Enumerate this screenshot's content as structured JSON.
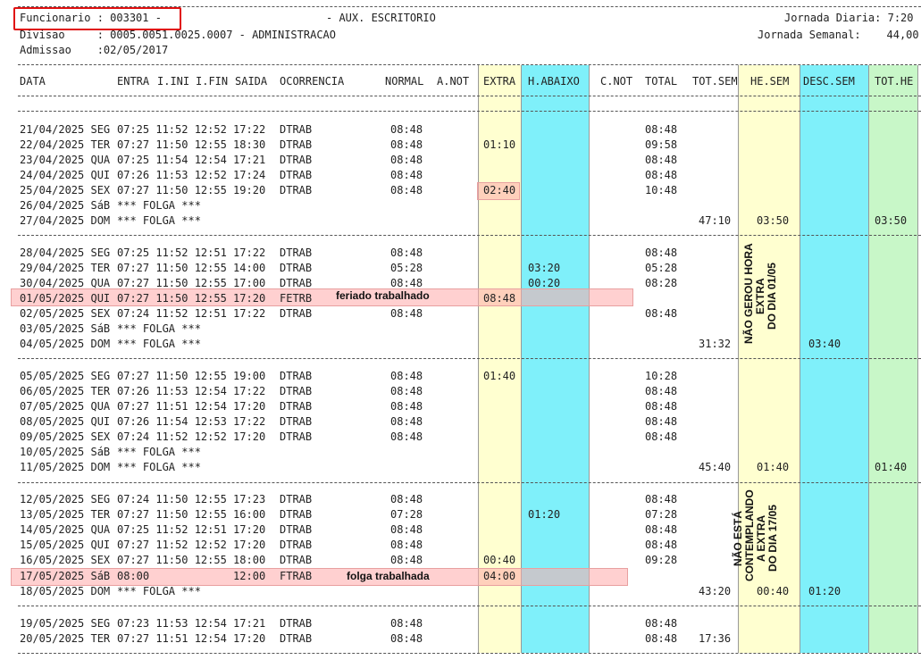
{
  "header": {
    "funcionario": "Funcionario : 003301 -",
    "cargo": "- AUX. ESCRITORIO",
    "divisao": "Divisao     : 0005.0051.0025.0007 - ADMINISTRACAO",
    "admissao": "Admissao    :02/05/2017",
    "jornada_diaria": "Jornada Diaria: 7:20",
    "jornada_semanal": "Jornada Semanal:    44,00"
  },
  "columns": {
    "data": "DATA",
    "entra": "ENTRA",
    "iini": "I.INI",
    "ifin": "I.FIN",
    "saida": "SAIDA",
    "ocorrencia": "OCORRENCIA",
    "normal": "NORMAL",
    "anot": "A.NOT",
    "extra": "EXTRA",
    "habaixo": "H.ABAIXO",
    "cnot": "C.NOT",
    "total": "TOTAL",
    "totsem": "TOT.SEM",
    "hesem": "HE.SEM",
    "descsem": "DESC.SEM",
    "tothe": "TOT.HE"
  },
  "colors": {
    "extra_bg": "#ffffd0",
    "habaixo_bg": "#7ff0fa",
    "hesem_bg": "#ffffd0",
    "descsem_bg": "#7ff0fa",
    "tothe_bg": "#c8f7c8",
    "highlight": "#f8b4b4",
    "redbox": "#e01010"
  },
  "rows": [
    {
      "date": "21/04/2025 SEG",
      "times": "07:25 11:52 12:52 17:22",
      "oc": "DTRAB",
      "normal": "08:48",
      "total": "08:48"
    },
    {
      "date": "22/04/2025 TER",
      "times": "07:27 11:50 12:55 18:30",
      "oc": "DTRAB",
      "normal": "08:48",
      "extra": "01:10",
      "total": "09:58"
    },
    {
      "date": "23/04/2025 QUA",
      "times": "07:25 11:54 12:54 17:21",
      "oc": "DTRAB",
      "normal": "08:48",
      "total": "08:48"
    },
    {
      "date": "24/04/2025 QUI",
      "times": "07:26 11:53 12:52 17:24",
      "oc": "DTRAB",
      "normal": "08:48",
      "total": "08:48"
    },
    {
      "date": "25/04/2025 SEX",
      "times": "07:27 11:50 12:55 19:20",
      "oc": "DTRAB",
      "normal": "08:48",
      "extra": "02:40",
      "total": "10:48"
    },
    {
      "date": "26/04/2025 SáB",
      "times": "*** FOLGA ***"
    },
    {
      "date": "27/04/2025 DOM",
      "times": "*** FOLGA ***",
      "totsem": "47:10",
      "hesem": "03:50",
      "tothe": "03:50"
    },
    {
      "date": "28/04/2025 SEG",
      "times": "07:25 11:52 12:51 17:22",
      "oc": "DTRAB",
      "normal": "08:48",
      "total": "08:48"
    },
    {
      "date": "29/04/2025 TER",
      "times": "07:27 11:50 12:55 14:00",
      "oc": "DTRAB",
      "normal": "05:28",
      "habaixo": "03:20",
      "total": "05:28"
    },
    {
      "date": "30/04/2025 QUA",
      "times": "07:27 11:50 12:55 17:00",
      "oc": "DTRAB",
      "normal": "08:48",
      "habaixo": "00:20",
      "total": "08:28"
    },
    {
      "date": "01/05/2025 QUI",
      "times": "07:27 11:50 12:55 17:20",
      "oc": "FETRB",
      "extra": "08:48"
    },
    {
      "date": "02/05/2025 SEX",
      "times": "07:24 11:52 12:51 17:22",
      "oc": "DTRAB",
      "normal": "08:48",
      "total": "08:48"
    },
    {
      "date": "03/05/2025 SáB",
      "times": "*** FOLGA ***"
    },
    {
      "date": "04/05/2025 DOM",
      "times": "*** FOLGA ***",
      "totsem": "31:32",
      "descsem": "03:40"
    },
    {
      "date": "05/05/2025 SEG",
      "times": "07:27 11:50 12:55 19:00",
      "oc": "DTRAB",
      "normal": "08:48",
      "extra": "01:40",
      "total": "10:28"
    },
    {
      "date": "06/05/2025 TER",
      "times": "07:26 11:53 12:54 17:22",
      "oc": "DTRAB",
      "normal": "08:48",
      "total": "08:48"
    },
    {
      "date": "07/05/2025 QUA",
      "times": "07:27 11:51 12:54 17:20",
      "oc": "DTRAB",
      "normal": "08:48",
      "total": "08:48"
    },
    {
      "date": "08/05/2025 QUI",
      "times": "07:26 11:54 12:53 17:22",
      "oc": "DTRAB",
      "normal": "08:48",
      "total": "08:48"
    },
    {
      "date": "09/05/2025 SEX",
      "times": "07:24 11:52 12:52 17:20",
      "oc": "DTRAB",
      "normal": "08:48",
      "total": "08:48"
    },
    {
      "date": "10/05/2025 SáB",
      "times": "*** FOLGA ***"
    },
    {
      "date": "11/05/2025 DOM",
      "times": "*** FOLGA ***",
      "totsem": "45:40",
      "hesem": "01:40",
      "tothe": "01:40"
    },
    {
      "date": "12/05/2025 SEG",
      "times": "07:24 11:50 12:55 17:23",
      "oc": "DTRAB",
      "normal": "08:48",
      "total": "08:48"
    },
    {
      "date": "13/05/2025 TER",
      "times": "07:27 11:50 12:55 16:00",
      "oc": "DTRAB",
      "normal": "07:28",
      "habaixo": "01:20",
      "total": "07:28"
    },
    {
      "date": "14/05/2025 QUA",
      "times": "07:25 11:52 12:51 17:20",
      "oc": "DTRAB",
      "normal": "08:48",
      "total": "08:48"
    },
    {
      "date": "15/05/2025 QUI",
      "times": "07:27 11:52 12:52 17:20",
      "oc": "DTRAB",
      "normal": "08:48",
      "total": "08:48"
    },
    {
      "date": "16/05/2025 SEX",
      "times": "07:27 11:50 12:55 18:00",
      "oc": "DTRAB",
      "normal": "08:48",
      "extra": "00:40",
      "total": "09:28"
    },
    {
      "date": "17/05/2025 SáB",
      "times": "08:00             12:00",
      "oc": "FTRAB",
      "extra": "04:00"
    },
    {
      "date": "18/05/2025 DOM",
      "times": "*** FOLGA ***",
      "totsem": "43:20",
      "hesem": "00:40",
      "descsem": "01:20"
    },
    {
      "date": "19/05/2025 SEG",
      "times": "07:23 11:53 12:54 17:21",
      "oc": "DTRAB",
      "normal": "08:48",
      "total": "08:48"
    },
    {
      "date": "20/05/2025 TER",
      "times": "07:27 11:51 12:54 17:20",
      "oc": "DTRAB",
      "normal": "08:48",
      "total": "08:48",
      "totsem": "17:36"
    }
  ],
  "annotations": {
    "feriado": "feriado trabalhado",
    "folga": "folga trabalhada",
    "note1": "NÃO GEROU HORA\nEXTRA\nDO DIA 01/05",
    "note2": "NÃO ESTÁ\nCONTEMPLANDO\nA EXTRA\nDO DIA 17/05"
  }
}
